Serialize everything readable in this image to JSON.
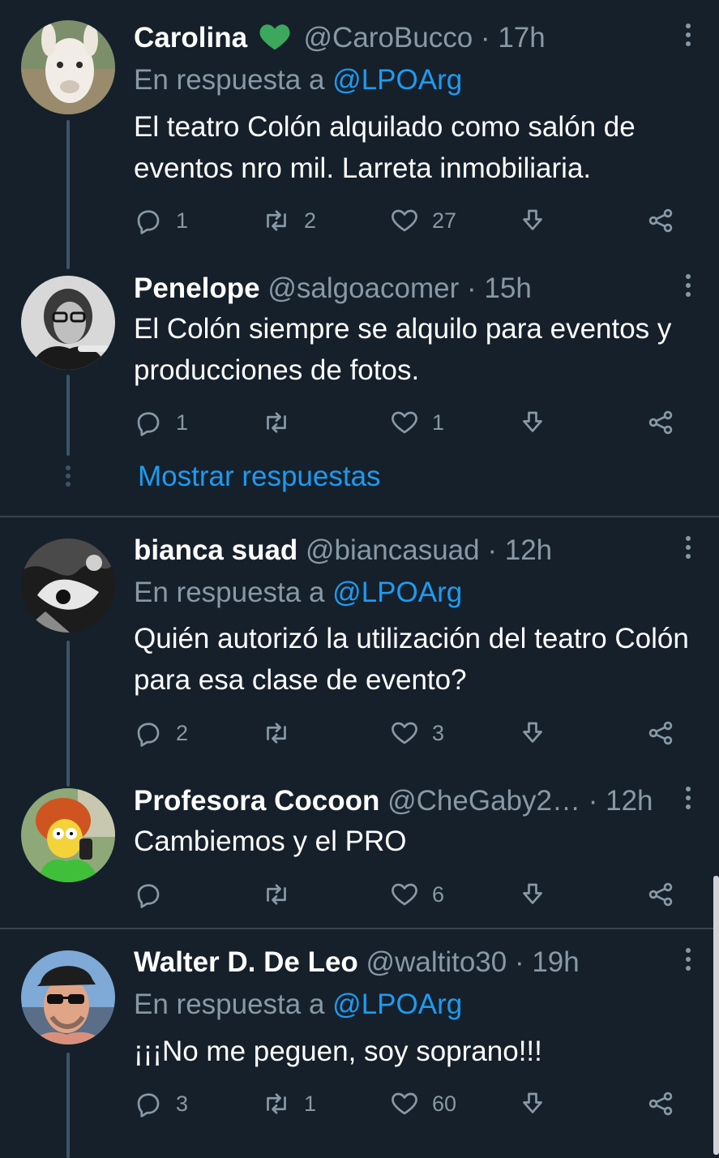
{
  "reply_prefix": "En respuesta a",
  "show_replies_label": "Mostrar respuestas",
  "colors": {
    "background": "#15202b",
    "accent": "#1d9bf0",
    "muted": "#8899a6",
    "heart": "#3ba85c"
  },
  "tweets": [
    {
      "name": "Carolina",
      "badge": "green-heart",
      "handle": "@CaroBucco",
      "time": "17h",
      "reply_to": "@LPOArg",
      "text": "El teatro Colón alquilado como salón de eventos nro mil. Larreta inmobiliaria.",
      "replies": "1",
      "retweets": "2",
      "likes": "27"
    },
    {
      "name": "Penelope",
      "handle": "@salgoacomer",
      "time": "15h",
      "text": "El Colón siempre se alquilo para eventos y producciones de fotos.",
      "replies": "1",
      "retweets": "",
      "likes": "1"
    },
    {
      "name": "bianca suad",
      "handle": "@biancasuad",
      "time": "12h",
      "reply_to": "@LPOArg",
      "text": "Quién autorizó la utilización del teatro Colón para esa clase de evento?",
      "replies": "2",
      "retweets": "",
      "likes": "3"
    },
    {
      "name": "Profesora Cocoon",
      "handle": "@CheGaby2…",
      "time": "12h",
      "text": "Cambiemos y el PRO",
      "replies": "",
      "retweets": "",
      "likes": "6"
    },
    {
      "name": "Walter D. De Leo",
      "handle": "@waltito30",
      "time": "19h",
      "reply_to": "@LPOArg",
      "text": "¡¡¡No me peguen, soy soprano!!!",
      "replies": "3",
      "retweets": "1",
      "likes": "60"
    }
  ]
}
